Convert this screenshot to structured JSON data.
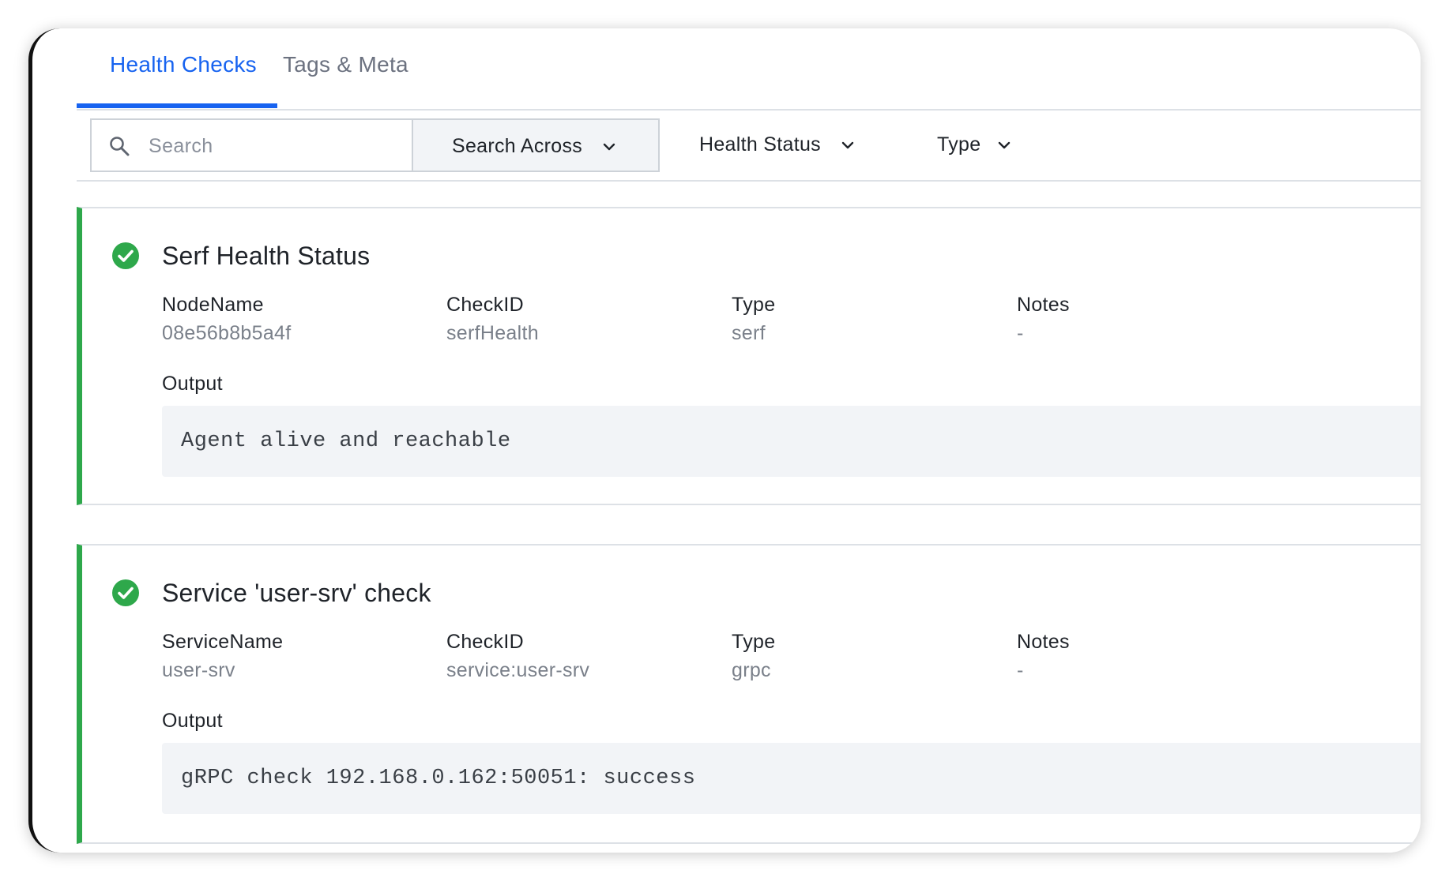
{
  "tabs": [
    {
      "label": "Health Checks",
      "active": true
    },
    {
      "label": "Tags & Meta",
      "active": false
    }
  ],
  "toolbar": {
    "search_placeholder": "Search",
    "search_across_label": "Search Across",
    "health_status_label": "Health Status",
    "type_label": "Type"
  },
  "colors": {
    "accent": "#1763f0",
    "passing": "#2ea84b"
  },
  "checks": [
    {
      "title": "Serf Health Status",
      "status": "passing",
      "fields": [
        {
          "label": "NodeName",
          "value": "08e56b8b5a4f"
        },
        {
          "label": "CheckID",
          "value": "serfHealth"
        },
        {
          "label": "Type",
          "value": "serf"
        },
        {
          "label": "Notes",
          "value": "-"
        }
      ],
      "output_label": "Output",
      "output": "Agent alive and reachable"
    },
    {
      "title": "Service 'user-srv' check",
      "status": "passing",
      "fields": [
        {
          "label": "ServiceName",
          "value": "user-srv"
        },
        {
          "label": "CheckID",
          "value": "service:user-srv"
        },
        {
          "label": "Type",
          "value": "grpc"
        },
        {
          "label": "Notes",
          "value": "-"
        }
      ],
      "output_label": "Output",
      "output": "gRPC check 192.168.0.162:50051: success"
    }
  ]
}
